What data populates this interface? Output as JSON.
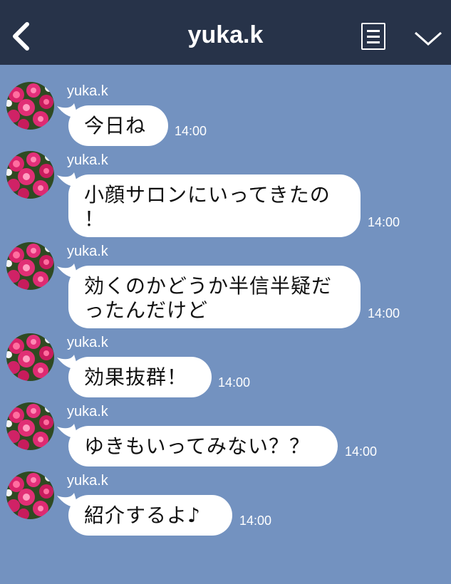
{
  "header": {
    "title": "yuka.k",
    "back_icon": "chevron-left-icon",
    "menu_icon": "notes-icon",
    "more_icon": "chevron-down-icon"
  },
  "colors": {
    "header_bg": "#273349",
    "chat_bg": "#7392c0",
    "bubble": "#ffffff"
  },
  "messages": [
    {
      "sender": "yuka.k",
      "lines": [
        "今日ね"
      ],
      "time": "14:00"
    },
    {
      "sender": "yuka.k",
      "lines": [
        "小顔サロンにいってきたの",
        "！"
      ],
      "time": "14:00"
    },
    {
      "sender": "yuka.k",
      "lines": [
        "効くのかどうか半信半疑だ",
        "ったんだけど"
      ],
      "time": "14:00"
    },
    {
      "sender": "yuka.k",
      "lines": [
        "効果抜群！"
      ],
      "time": "14:00"
    },
    {
      "sender": "yuka.k",
      "lines": [
        "ゆきもいってみない？？"
      ],
      "time": "14:00"
    },
    {
      "sender": "yuka.k",
      "lines": [
        "紹介するよ♪"
      ],
      "time": "14:00"
    }
  ]
}
